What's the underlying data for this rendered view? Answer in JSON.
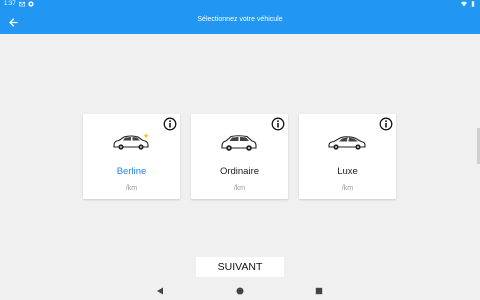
{
  "status_bar": {
    "time": "1:37",
    "icons_left": [
      "gmail-icon",
      "at-icon"
    ],
    "icons_right": [
      "wifi-icon",
      "battery-icon"
    ]
  },
  "app_bar": {
    "title": "Sélectionnez votre véhicule",
    "back_icon": "arrow-left-icon"
  },
  "vehicles": [
    {
      "name": "Berline",
      "price": "/km",
      "selected": true,
      "icon": "sedan-sparkle-icon"
    },
    {
      "name": "Ordinaire",
      "price": "/km",
      "selected": false,
      "icon": "hatchback-icon"
    },
    {
      "name": "Luxe",
      "price": "/km",
      "selected": false,
      "icon": "luxury-car-icon"
    }
  ],
  "next_button": {
    "label": "SUIVANT"
  },
  "colors": {
    "primary": "#2196f3",
    "selected_text": "#1e88e5",
    "background": "#f0f0f0"
  }
}
